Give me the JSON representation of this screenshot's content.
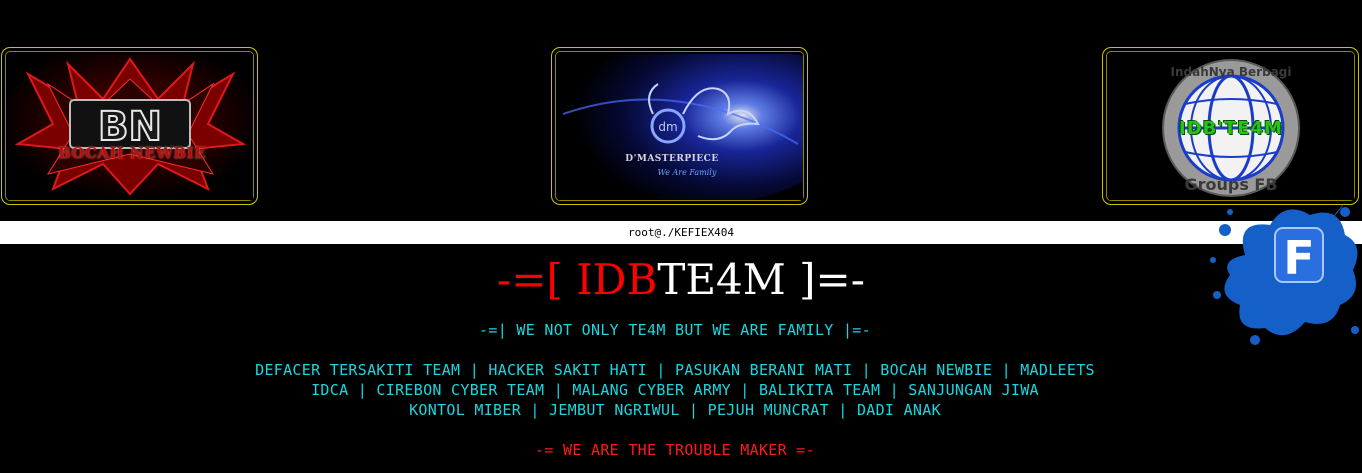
{
  "logos": {
    "left": {
      "text": "BOCAH NEWBIE",
      "initials": "BN"
    },
    "middle": {
      "text": "D'MASTERPIECE",
      "tagline": "We Are Family",
      "initials": "dm"
    },
    "right": {
      "text": "IDB'TE4M",
      "arc_top": "IndahNya Berbagi",
      "arc_bottom": "Groups FB"
    }
  },
  "prompt": {
    "text": "root@./KEFIEX404"
  },
  "title": {
    "prefix": "-=[ ",
    "red_part": "IDB",
    "white_part": "TE4M",
    "suffix": " ]=-"
  },
  "motto": "-=| WE NOT ONLY TE4M BUT WE ARE FAMILY |=-",
  "groups": [
    "DEFACER TERSAKITI TEAM | HACKER SAKIT HATI | PASUKAN BERANI MATI | BOCAH NEWBIE | MADLEETS",
    "IDCA | CIREBON CYBER TEAM | MALANG CYBER ARMY | BALIKITA TEAM | SANJUNGAN JIWA",
    "KONTOL MIBER | JEMBUT NGRIWUL | PEJUH MUNCRAT | DADI ANAK"
  ],
  "trouble": "-= WE ARE THE TROUBLE MAKER =-",
  "badge": {
    "letter": "F"
  },
  "colors": {
    "background": "#000000",
    "cyan": "#19d6e0",
    "red": "#ff0000",
    "logo_border": "#c9c200",
    "splash_blue": "#1560c8"
  }
}
